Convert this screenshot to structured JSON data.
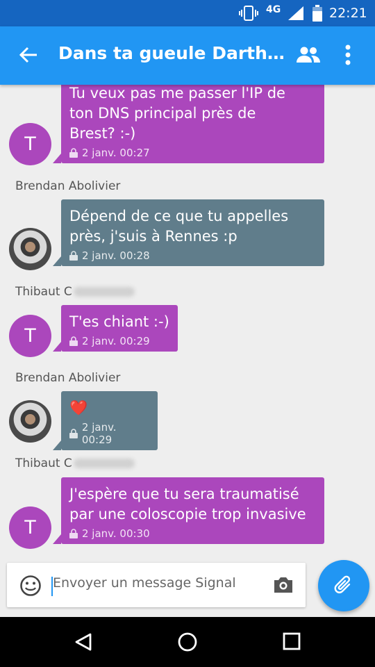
{
  "status_bar": {
    "network": "4G",
    "time": "22:21"
  },
  "app_bar": {
    "title": "Dans ta gueule Darth…"
  },
  "messages": [
    {
      "avatar_letter": "T",
      "text": "Tu veux pas me passer l'IP de\nton DNS principal près de\nBrest? :-)",
      "time": "2 janv. 00:27"
    },
    {
      "sender": "Brendan Abolivier",
      "text": "Dépend de ce que tu appelles\nprès, j'suis à Rennes :p",
      "time": "2 janv. 00:28"
    },
    {
      "sender": "Thibaut C",
      "avatar_letter": "T",
      "text": "T'es chiant :-)",
      "time": "2 janv. 00:29"
    },
    {
      "sender": "Brendan Abolivier",
      "text": "❤️",
      "time": "2 janv. 00:29"
    },
    {
      "sender": "Thibaut C",
      "avatar_letter": "T",
      "text": "J'espère que tu sera traumatisé\npar une coloscopie trop invasive",
      "time": "2 janv. 00:30"
    }
  ],
  "compose": {
    "placeholder": "Envoyer un message Signal"
  },
  "colors": {
    "app_bar": "#2196f3",
    "status_bar": "#1565c0",
    "bubble_purple": "#ab47bc",
    "bubble_grey": "#607d8b"
  },
  "icons": [
    "vibrate-icon",
    "signal-icon",
    "battery-icon",
    "back-arrow-icon",
    "group-icon",
    "more-vert-icon",
    "lock-icon",
    "emoji-icon",
    "camera-icon",
    "attach-icon",
    "nav-back-icon",
    "nav-home-icon",
    "nav-recents-icon"
  ]
}
